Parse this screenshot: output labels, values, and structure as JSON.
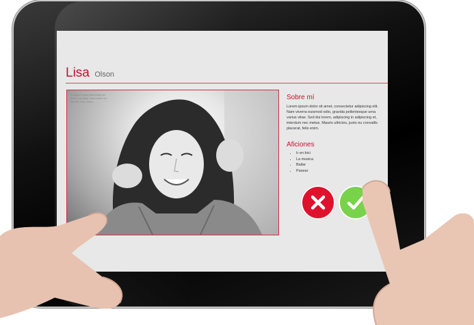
{
  "profile": {
    "first_name": "Lisa",
    "last_name": "Olson",
    "photo_credit": [
      "Fotograf: www.fotomehler.se",
      "Make Up Artist: www.elenn.se",
      "Modell: Lisa Olson"
    ]
  },
  "about": {
    "heading": "Sobre mí",
    "text": "Lorem ipsum dolor sit amet, consectetur adipiscing elit. Nam viverra euismod odio, gravida pellentesque urna varius vitae. Sed dui lorem, adipiscing in adipiscing et, interdum nec metus. Mauris ultricies, justo eu convallis placerat, felis enim."
  },
  "hobbies": {
    "heading": "Aficiones",
    "items": [
      "Ir en bici",
      "La musica",
      "Bailar",
      "Pasear"
    ]
  },
  "actions": {
    "reject_icon": "x-icon",
    "accept_icon": "check-icon",
    "reject_color": "#e0112c",
    "accept_color": "#78d24a"
  },
  "colors": {
    "accent": "#c8102e",
    "screen_bg": "#e8e8e8"
  }
}
